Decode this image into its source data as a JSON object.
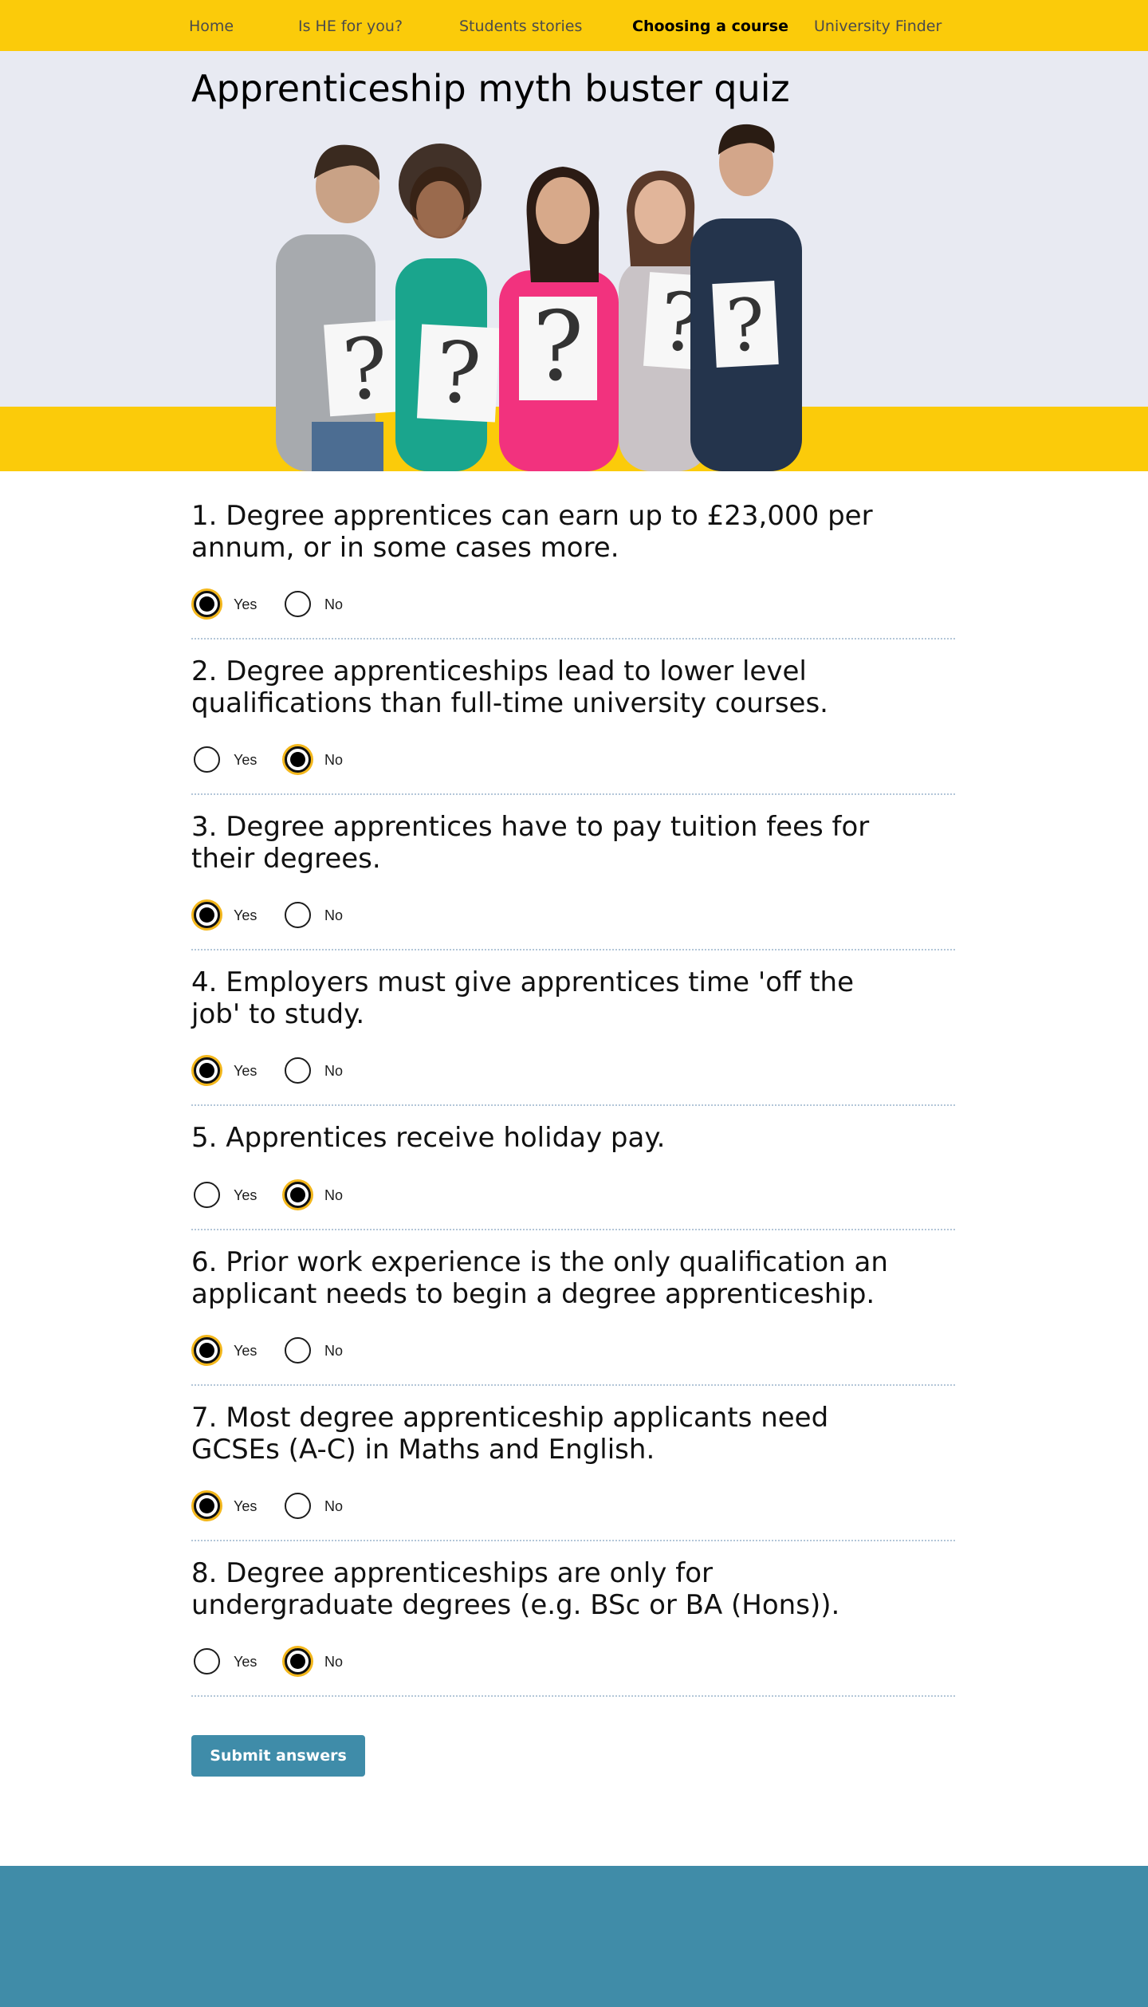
{
  "nav": {
    "items": [
      {
        "label": "Home",
        "active": false
      },
      {
        "label": "Is HE for you?",
        "active": false
      },
      {
        "label": "Students stories",
        "active": false
      },
      {
        "label": "Choosing a course",
        "active": true
      },
      {
        "label": "University Finder",
        "active": false
      }
    ]
  },
  "page": {
    "title": "Apprenticeship myth buster quiz"
  },
  "quiz": {
    "questions": [
      {
        "text": "1. Degree apprentices can earn up to £23,000 per annum, or in some cases more.",
        "options": [
          "Yes",
          "No"
        ],
        "selected": "Yes"
      },
      {
        "text": "2. Degree apprenticeships lead to lower level qualifications than full-time university courses.",
        "options": [
          "Yes",
          "No"
        ],
        "selected": "No"
      },
      {
        "text": "3. Degree apprentices have to pay tuition fees for their degrees.",
        "options": [
          "Yes",
          "No"
        ],
        "selected": "Yes"
      },
      {
        "text": "4. Employers must give apprentices time 'off the job' to study.",
        "options": [
          "Yes",
          "No"
        ],
        "selected": "Yes"
      },
      {
        "text": "5. Apprentices receive holiday pay.",
        "options": [
          "Yes",
          "No"
        ],
        "selected": "No"
      },
      {
        "text": "6. Prior work experience is the only qualification an applicant needs to begin a degree apprenticeship.",
        "options": [
          "Yes",
          "No"
        ],
        "selected": "Yes"
      },
      {
        "text": "7. Most degree apprenticeship applicants need GCSEs (A-C) in Maths and English.",
        "options": [
          "Yes",
          "No"
        ],
        "selected": "Yes"
      },
      {
        "text": "8. Degree apprenticeships are only for undergraduate degrees (e.g. BSc or BA (Hons)).",
        "options": [
          "Yes",
          "No"
        ],
        "selected": "No"
      }
    ],
    "submit_label": "Submit answers"
  },
  "colors": {
    "nav_bg": "#fbcb0a",
    "hero_bg": "#e8eaf2",
    "accent_ring": "#f3b71c",
    "button_bg": "#3f8ca9",
    "footer_bg": "#408ca8"
  }
}
